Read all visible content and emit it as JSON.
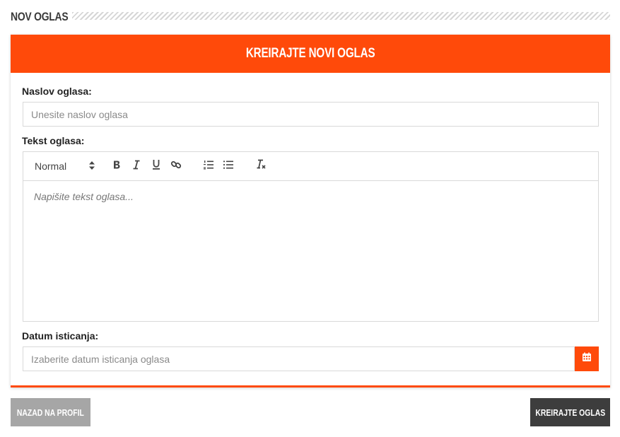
{
  "page": {
    "title": "NOV OGLAS"
  },
  "card": {
    "title": "KREIRAJTE NOVI OGLAS"
  },
  "form": {
    "title_label": "Naslov oglasa:",
    "title_placeholder": "Unesite naslov oglasa",
    "text_label": "Tekst oglasa:",
    "editor": {
      "format_select": "Normal",
      "placeholder": "Napišite tekst oglasa..."
    },
    "date_label": "Datum isticanja:",
    "date_placeholder": "Izaberite datum isticanja oglasa"
  },
  "buttons": {
    "back": "NAZAD NA PROFIL",
    "create": "KREIRAJTE OGLAS"
  },
  "colors": {
    "accent": "#ff4a0a",
    "back_button": "#a6a6a6",
    "create_button": "#3d3d3d"
  },
  "icons": [
    "bold-icon",
    "italic-icon",
    "underline-icon",
    "link-icon",
    "ordered-list-icon",
    "bullet-list-icon",
    "clear-format-icon",
    "calendar-icon",
    "select-arrows-icon"
  ]
}
